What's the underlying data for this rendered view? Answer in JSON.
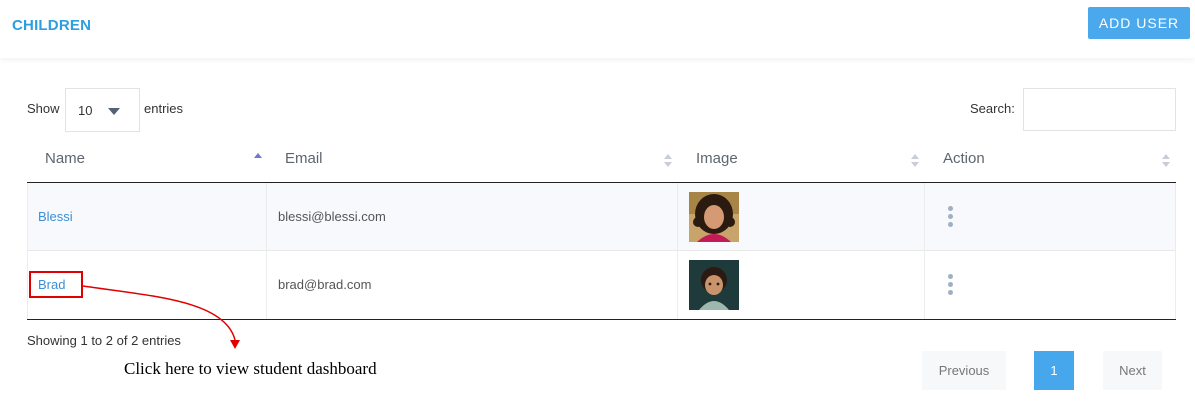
{
  "header": {
    "title": "CHILDREN",
    "add_user_label": "ADD USER"
  },
  "controls": {
    "show_label": "Show",
    "page_length": "10",
    "entries_label": "entries",
    "search_label": "Search:",
    "search_value": ""
  },
  "table": {
    "columns": [
      "Name",
      "Email",
      "Image",
      "Action"
    ],
    "sort": {
      "column": "Name",
      "direction": "ascending"
    },
    "rows": [
      {
        "name": "Blessi",
        "email": "blessi@blessi.com",
        "image": "woman-curly-hair-photo"
      },
      {
        "name": "Brad",
        "email": "brad@brad.com",
        "image": "child-photo"
      }
    ]
  },
  "footer": {
    "info": "Showing 1 to 2 of 2 entries",
    "prev_label": "Previous",
    "current_page": "1",
    "next_label": "Next"
  },
  "annotation": {
    "text": "Click here to view student dashboard",
    "color": "#e00000"
  },
  "colors": {
    "accent": "#2d9ee0",
    "button": "#4aa8ec",
    "link": "#3b8fd8",
    "annotation": "#e00000"
  }
}
